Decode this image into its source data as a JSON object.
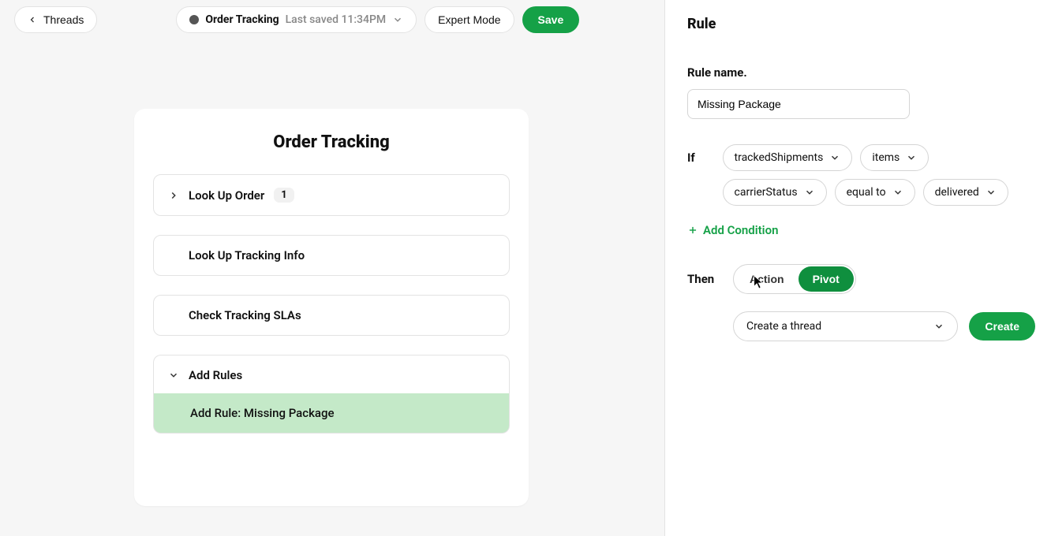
{
  "topbar": {
    "threads": "Threads",
    "title": "Order Tracking",
    "saved": "Last saved 11:34PM",
    "expert": "Expert Mode",
    "save": "Save"
  },
  "card": {
    "title": "Order Tracking",
    "rows": [
      {
        "label": "Look Up Order",
        "badge": "1",
        "expand": "right"
      },
      {
        "label": "Look Up Tracking Info"
      },
      {
        "label": "Check Tracking SLAs"
      }
    ],
    "rulesHeader": "Add Rules",
    "ruleItem": "Add Rule: Missing Package"
  },
  "panel": {
    "heading": "Rule",
    "nameLabel": "Rule name.",
    "nameValue": "Missing Package",
    "ifLabel": "If",
    "conditions": [
      "trackedShipments",
      "items",
      "carrierStatus",
      "equal to",
      "delivered"
    ],
    "addCondition": "Add Condition",
    "thenLabel": "Then",
    "toggle": {
      "a": "Action",
      "b": "Pivot",
      "active": "b"
    },
    "thenSelect": "Create a thread",
    "createBtn": "Create"
  },
  "colors": {
    "accent": "#15a147",
    "subrow": "#c4e9c8"
  }
}
